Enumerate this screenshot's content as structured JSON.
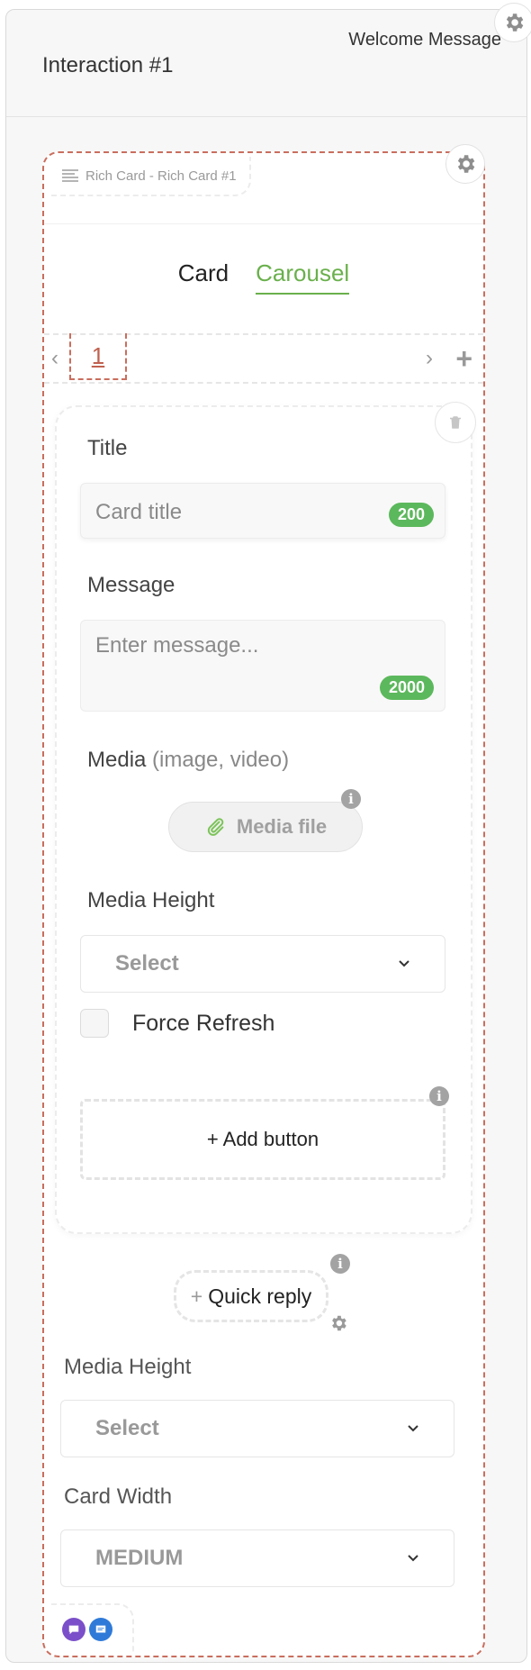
{
  "header": {
    "title": "Interaction #1",
    "label": "Welcome Message"
  },
  "rich_card": {
    "tab_label": "Rich Card - Rich Card #1",
    "modes": [
      "Card",
      "Carousel"
    ],
    "active_mode": "Carousel",
    "pagination": {
      "current": "1",
      "prev": "‹",
      "next": "›",
      "add": "+"
    }
  },
  "card": {
    "title_label": "Title",
    "title_placeholder": "Card title",
    "title_counter": "200",
    "message_label": "Message",
    "message_placeholder": "Enter message...",
    "message_counter": "2000",
    "media_label": "Media",
    "media_hint": "(image, video)",
    "media_button": "Media file",
    "media_height_label": "Media Height",
    "media_height_value": "Select",
    "force_refresh_label": "Force Refresh",
    "force_refresh_checked": false,
    "add_button_label": "+ Add button"
  },
  "quick_reply": {
    "plus": "+",
    "label": "Quick reply"
  },
  "carousel_settings": {
    "media_height_label": "Media Height",
    "media_height_value": "Select",
    "card_width_label": "Card Width",
    "card_width_value": "MEDIUM"
  },
  "colors": {
    "accent_green": "#6ab04c",
    "dashed_red": "#c96e5e",
    "counter_green": "#5cb85c",
    "chat_purple": "#7b4fc9",
    "chat_blue": "#2f7ad8"
  },
  "icons": {
    "info": "i",
    "gear": "gear-icon",
    "trash": "trash-icon",
    "paperclip": "paperclip-icon"
  }
}
